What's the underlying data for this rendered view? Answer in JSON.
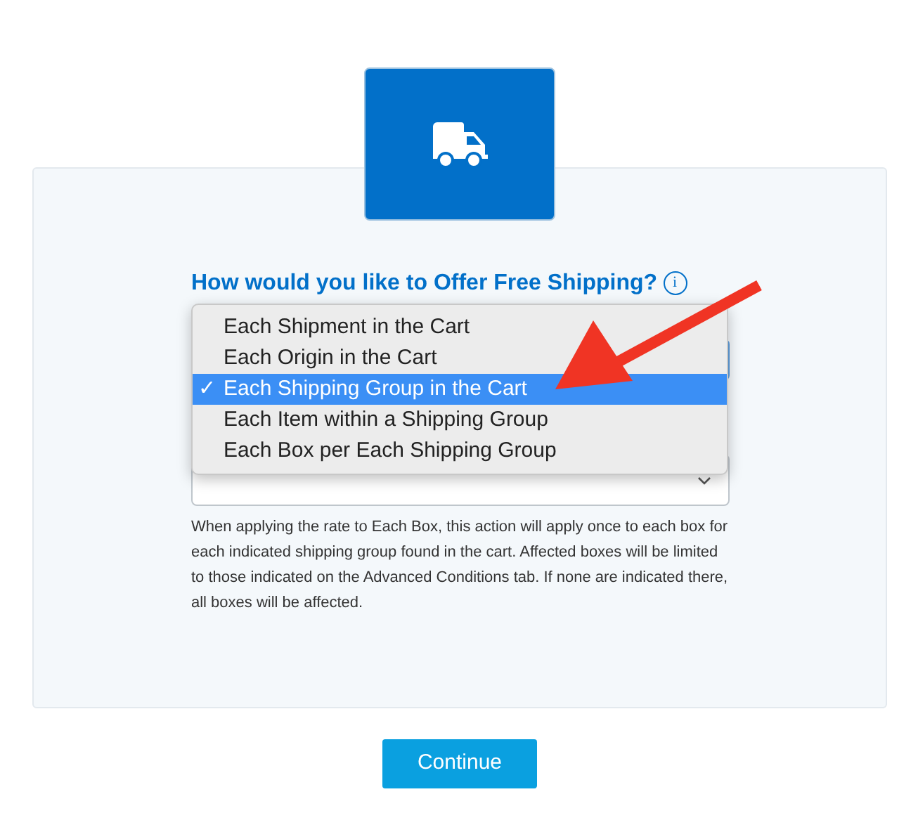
{
  "question": {
    "title": "How would you like to Offer Free Shipping?",
    "info_icon": "i"
  },
  "dropdown": {
    "expanded": true,
    "check_mark": "✓",
    "options": [
      {
        "label": "Each Shipment in the Cart",
        "selected": false
      },
      {
        "label": "Each Origin in the Cart",
        "selected": false
      },
      {
        "label": "Each Shipping Group in the Cart",
        "selected": true
      },
      {
        "label": "Each Item within a Shipping Group",
        "selected": false
      },
      {
        "label": "Each Box per Each Shipping Group",
        "selected": false
      }
    ]
  },
  "help_text": "When applying the rate to Each Box, this action will apply once to each box for each indicated shipping group found in the cart. Affected boxes will be limited to those indicated on the Advanced Conditions tab. If none are indicated there, all boxes will be affected.",
  "button": {
    "label": "Continue"
  }
}
